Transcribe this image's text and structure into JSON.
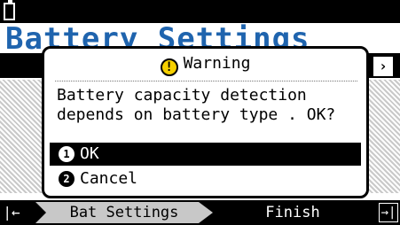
{
  "background": {
    "title": "Battery Settings"
  },
  "dialog": {
    "header_icon": "!",
    "header": "Warning",
    "message": "Battery capacity detection\ndepends on battery type . OK?",
    "options": [
      {
        "number": "1",
        "label": "OK",
        "selected": true
      },
      {
        "number": "2",
        "label": "Cancel",
        "selected": false
      }
    ]
  },
  "bottom_bar": {
    "tabs": [
      "Bat Settings",
      "Finish"
    ]
  },
  "icons": {
    "status": "battery-icon",
    "warning": "warning-icon",
    "nav_left": "nav-left-icon",
    "nav_right": "nav-right-icon",
    "background_arrow": "chevron-right-icon"
  },
  "colors": {
    "title_blue": "#1f64ae",
    "warning_yellow": "#f6d000",
    "hatch": "#c9c9c9"
  }
}
